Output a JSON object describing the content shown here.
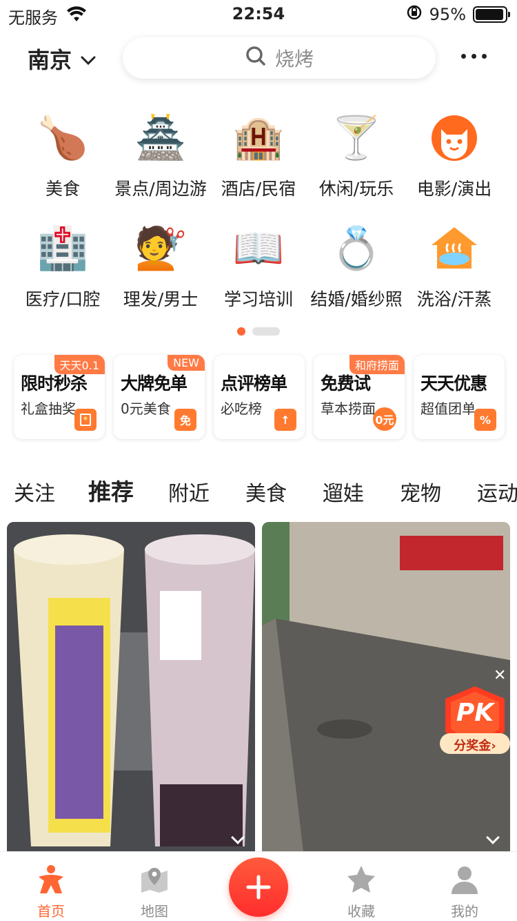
{
  "status_bar": {
    "carrier": "无服务",
    "time": "22:54",
    "battery": "95%",
    "battery_level": 0.95
  },
  "topbar": {
    "city": "南京",
    "search_placeholder": "烧烤"
  },
  "categories": [
    {
      "label": "美食",
      "icon": "roast-chicken-icon",
      "glyph": "🍗"
    },
    {
      "label": "景点/周边游",
      "icon": "pagoda-icon",
      "glyph": "🏯"
    },
    {
      "label": "酒店/民宿",
      "icon": "hotel-icon",
      "glyph": "🏨"
    },
    {
      "label": "休闲/玩乐",
      "icon": "cocktail-icon",
      "glyph": "🍸"
    },
    {
      "label": "电影/演出",
      "icon": "cat-mask-icon",
      "glyph": "🐱"
    },
    {
      "label": "医疗/口腔",
      "icon": "hospital-icon",
      "glyph": "🏥"
    },
    {
      "label": "理发/男士",
      "icon": "haircut-icon",
      "glyph": "💇"
    },
    {
      "label": "学习培训",
      "icon": "book-icon",
      "glyph": "📖"
    },
    {
      "label": "结婚/婚纱照",
      "icon": "ring-icon",
      "glyph": "💍"
    },
    {
      "label": "洗浴/汗蒸",
      "icon": "bath-icon",
      "glyph": "♨"
    }
  ],
  "promos": [
    {
      "title": "限时秒杀",
      "subtitle": "礼盒抽奖",
      "badge": "天天0.1",
      "mark": ""
    },
    {
      "title": "大牌免单",
      "subtitle": "0元美食",
      "badge": "NEW",
      "mark": "免"
    },
    {
      "title": "点评榜单",
      "subtitle": "必吃榜",
      "badge": "",
      "mark": "↑"
    },
    {
      "title": "免费试",
      "subtitle": "草本捞面",
      "badge": "和府捞面",
      "mark": "0元"
    },
    {
      "title": "天天优惠",
      "subtitle": "超值团单",
      "badge": "",
      "mark": "%"
    }
  ],
  "tabs": [
    "关注",
    "推荐",
    "附近",
    "美食",
    "遛娃",
    "宠物",
    "运动"
  ],
  "active_tab": "推荐",
  "pk": {
    "title": "PK",
    "label": "分奖金›"
  },
  "bottom_nav": {
    "home": "首页",
    "map": "地图",
    "favorites": "收藏",
    "me": "我的"
  },
  "colors": {
    "accent": "#ff6633",
    "fab": "#ff3b30"
  }
}
